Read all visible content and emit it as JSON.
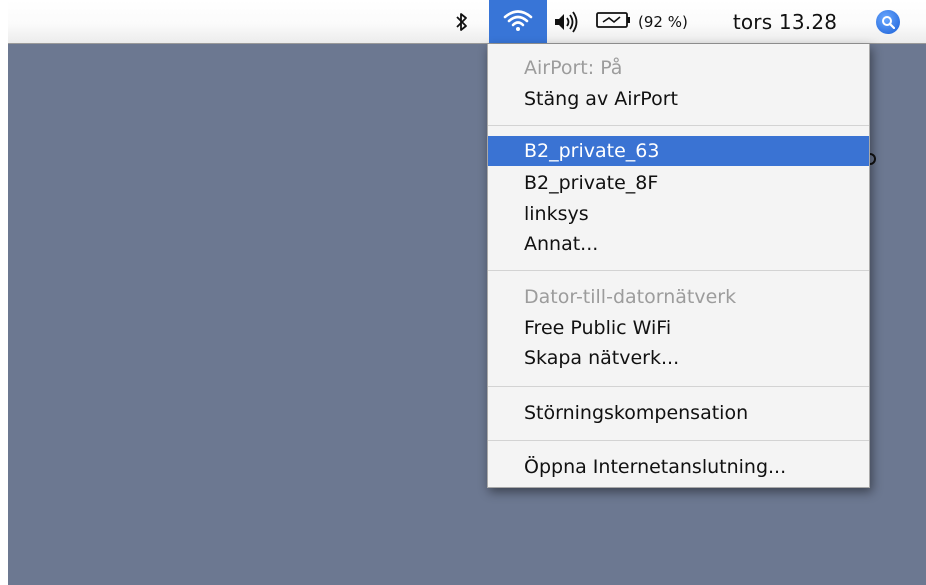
{
  "menubar": {
    "bluetooth_icon": "bluetooth-icon",
    "wifi_icon": "wifi-icon",
    "volume_icon": "volume-icon",
    "battery_icon": "battery-charging-icon",
    "battery_percent": "(92 %)",
    "clock": "tors 13.28",
    "spotlight_icon": "spotlight-search-icon",
    "wifi_highlight_color": "#3875d7"
  },
  "airport_menu": {
    "status": "AirPort: På",
    "turn_off": "Stäng av AirPort",
    "networks": [
      {
        "label": "B2_private_63",
        "selected": true
      },
      {
        "label": "B2_private_8F",
        "selected": false
      },
      {
        "label": "linksys",
        "selected": false
      },
      {
        "label": "Annat...",
        "selected": false
      }
    ],
    "adhoc_header": "Dator-till-datornätverk",
    "adhoc_networks": [
      {
        "label": "Free Public WiFi"
      },
      {
        "label": "Skapa nätverk..."
      }
    ],
    "interference": "Störningskompensation",
    "open_internet_connect": "Öppna Internetanslutning...",
    "selection_color": "#3a73d3"
  },
  "desktop": {
    "background_color": "#6c7891"
  }
}
